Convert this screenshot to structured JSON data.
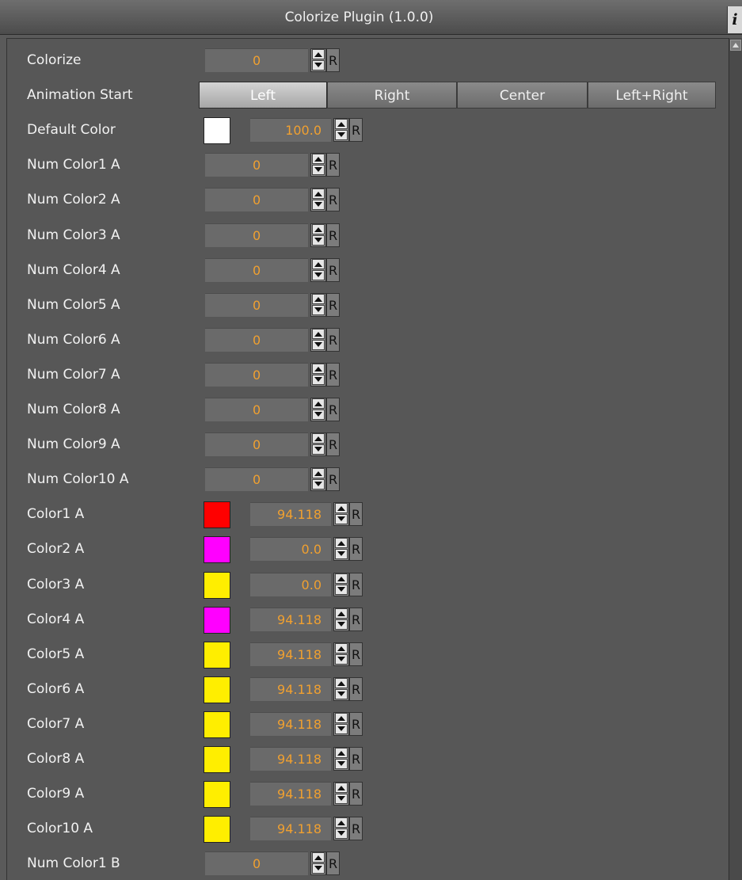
{
  "window": {
    "title": "Colorize Plugin (1.0.0)",
    "info_label": "i"
  },
  "rows": [
    {
      "type": "num",
      "label": "Colorize",
      "value": "0",
      "reset": "R"
    },
    {
      "type": "segmented",
      "label": "Animation Start",
      "options": [
        "Left",
        "Right",
        "Center",
        "Left+Right"
      ],
      "selected": "Left"
    },
    {
      "type": "color",
      "label": "Default Color",
      "color": "#ffffff",
      "value": "100.0",
      "reset": "R"
    },
    {
      "type": "num",
      "label": "Num Color1 A",
      "value": "0",
      "reset": "R"
    },
    {
      "type": "num",
      "label": "Num Color2 A",
      "value": "0",
      "reset": "R"
    },
    {
      "type": "num",
      "label": "Num Color3 A",
      "value": "0",
      "reset": "R"
    },
    {
      "type": "num",
      "label": "Num Color4 A",
      "value": "0",
      "reset": "R"
    },
    {
      "type": "num",
      "label": "Num Color5 A",
      "value": "0",
      "reset": "R"
    },
    {
      "type": "num",
      "label": "Num Color6 A",
      "value": "0",
      "reset": "R"
    },
    {
      "type": "num",
      "label": "Num Color7 A",
      "value": "0",
      "reset": "R"
    },
    {
      "type": "num",
      "label": "Num Color8 A",
      "value": "0",
      "reset": "R"
    },
    {
      "type": "num",
      "label": "Num Color9 A",
      "value": "0",
      "reset": "R"
    },
    {
      "type": "num",
      "label": "Num Color10 A",
      "value": "0",
      "reset": "R"
    },
    {
      "type": "color",
      "label": "Color1 A",
      "color": "#ff0000",
      "value": "94.118",
      "reset": "R"
    },
    {
      "type": "color",
      "label": "Color2 A",
      "color": "#ff00ff",
      "value": "0.0",
      "reset": "R"
    },
    {
      "type": "color",
      "label": "Color3 A",
      "color": "#ffee00",
      "value": "0.0",
      "reset": "R"
    },
    {
      "type": "color",
      "label": "Color4 A",
      "color": "#ff00ff",
      "value": "94.118",
      "reset": "R"
    },
    {
      "type": "color",
      "label": "Color5 A",
      "color": "#ffee00",
      "value": "94.118",
      "reset": "R"
    },
    {
      "type": "color",
      "label": "Color6 A",
      "color": "#ffee00",
      "value": "94.118",
      "reset": "R"
    },
    {
      "type": "color",
      "label": "Color7 A",
      "color": "#ffee00",
      "value": "94.118",
      "reset": "R"
    },
    {
      "type": "color",
      "label": "Color8 A",
      "color": "#ffee00",
      "value": "94.118",
      "reset": "R"
    },
    {
      "type": "color",
      "label": "Color9 A",
      "color": "#ffee00",
      "value": "94.118",
      "reset": "R"
    },
    {
      "type": "color",
      "label": "Color10 A",
      "color": "#ffee00",
      "value": "94.118",
      "reset": "R"
    },
    {
      "type": "num",
      "label": "Num Color1 B",
      "value": "0",
      "reset": "R"
    }
  ]
}
